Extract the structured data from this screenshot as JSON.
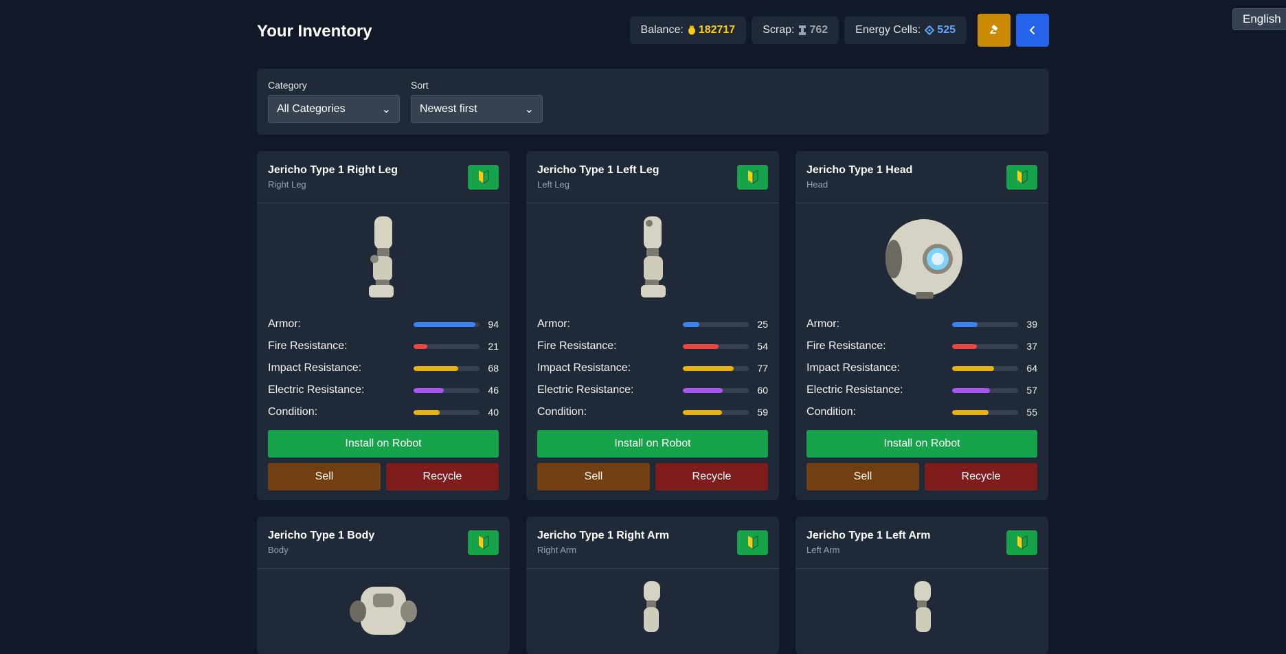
{
  "language": "English",
  "header": {
    "title": "Your Inventory",
    "balance_label": "Balance:",
    "balance_value": "182717",
    "scrap_label": "Scrap:",
    "scrap_value": "762",
    "energy_label": "Energy Cells:",
    "energy_value": "525",
    "icons": {
      "balance": "coin-icon",
      "scrap": "scrap-icon",
      "energy": "energy-cell-icon",
      "auction": "gavel-icon",
      "back": "chevron-left-icon"
    }
  },
  "filters": {
    "category_label": "Category",
    "category_value": "All Categories",
    "sort_label": "Sort",
    "sort_value": "Newest first"
  },
  "colors": {
    "armor": "#3b82f6",
    "fire": "#ef4444",
    "impact": "#eab308",
    "electric": "#a855f7",
    "condition": "#eab308"
  },
  "labels": {
    "armor": "Armor:",
    "fire": "Fire Resistance:",
    "impact": "Impact Resistance:",
    "electric": "Electric Resistance:",
    "condition": "Condition:",
    "install": "Install on Robot",
    "sell": "Sell",
    "recycle": "Recycle"
  },
  "items": [
    {
      "name": "Jericho Type 1 Right Leg",
      "type": "Right Leg",
      "armor": 94,
      "fire": 21,
      "impact": 68,
      "electric": 46,
      "condition": 40
    },
    {
      "name": "Jericho Type 1 Left Leg",
      "type": "Left Leg",
      "armor": 25,
      "fire": 54,
      "impact": 77,
      "electric": 60,
      "condition": 59
    },
    {
      "name": "Jericho Type 1 Head",
      "type": "Head",
      "armor": 39,
      "fire": 37,
      "impact": 64,
      "electric": 57,
      "condition": 55
    },
    {
      "name": "Jericho Type 1 Body",
      "type": "Body"
    },
    {
      "name": "Jericho Type 1 Right Arm",
      "type": "Right Arm"
    },
    {
      "name": "Jericho Type 1 Left Arm",
      "type": "Left Arm"
    }
  ]
}
